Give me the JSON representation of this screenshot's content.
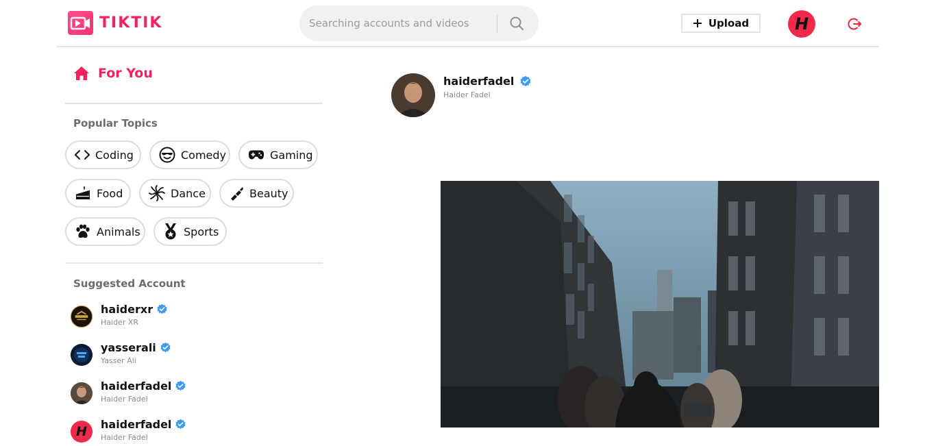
{
  "app": {
    "logo_text": "TIKTIK",
    "brand_color": "#f5215f"
  },
  "header": {
    "search": {
      "placeholder": "Searching accounts and videos",
      "value": ""
    },
    "upload_label": "Upload",
    "avatar_letter": "H"
  },
  "sidebar": {
    "for_you_label": "For You",
    "popular_topics_title": "Popular Topics",
    "topics": [
      {
        "label": "Coding",
        "icon": "code-icon"
      },
      {
        "label": "Comedy",
        "icon": "cool-face-icon"
      },
      {
        "label": "Gaming",
        "icon": "gamepad-icon"
      },
      {
        "label": "Food",
        "icon": "cake-icon"
      },
      {
        "label": "Dance",
        "icon": "dance-icon"
      },
      {
        "label": "Beauty",
        "icon": "lipstick-icon"
      },
      {
        "label": "Animals",
        "icon": "paw-icon"
      },
      {
        "label": "Sports",
        "icon": "medal-icon"
      }
    ],
    "suggested_title": "Suggested Account",
    "accounts": [
      {
        "username": "haiderxr",
        "name": "Haider XR",
        "verified": true
      },
      {
        "username": "yasserali",
        "name": "Yasser Ali",
        "verified": true
      },
      {
        "username": "haiderfadel",
        "name": "Haider Fadel",
        "verified": true
      },
      {
        "username": "haiderfadel",
        "name": "Haider Fadel",
        "verified": true
      }
    ]
  },
  "post": {
    "username": "haiderfadel",
    "name": "Haider Fadel",
    "verified": true
  },
  "colors": {
    "verified_badge": "#3d9bf0",
    "avatar_red": "#ef2a4a"
  }
}
